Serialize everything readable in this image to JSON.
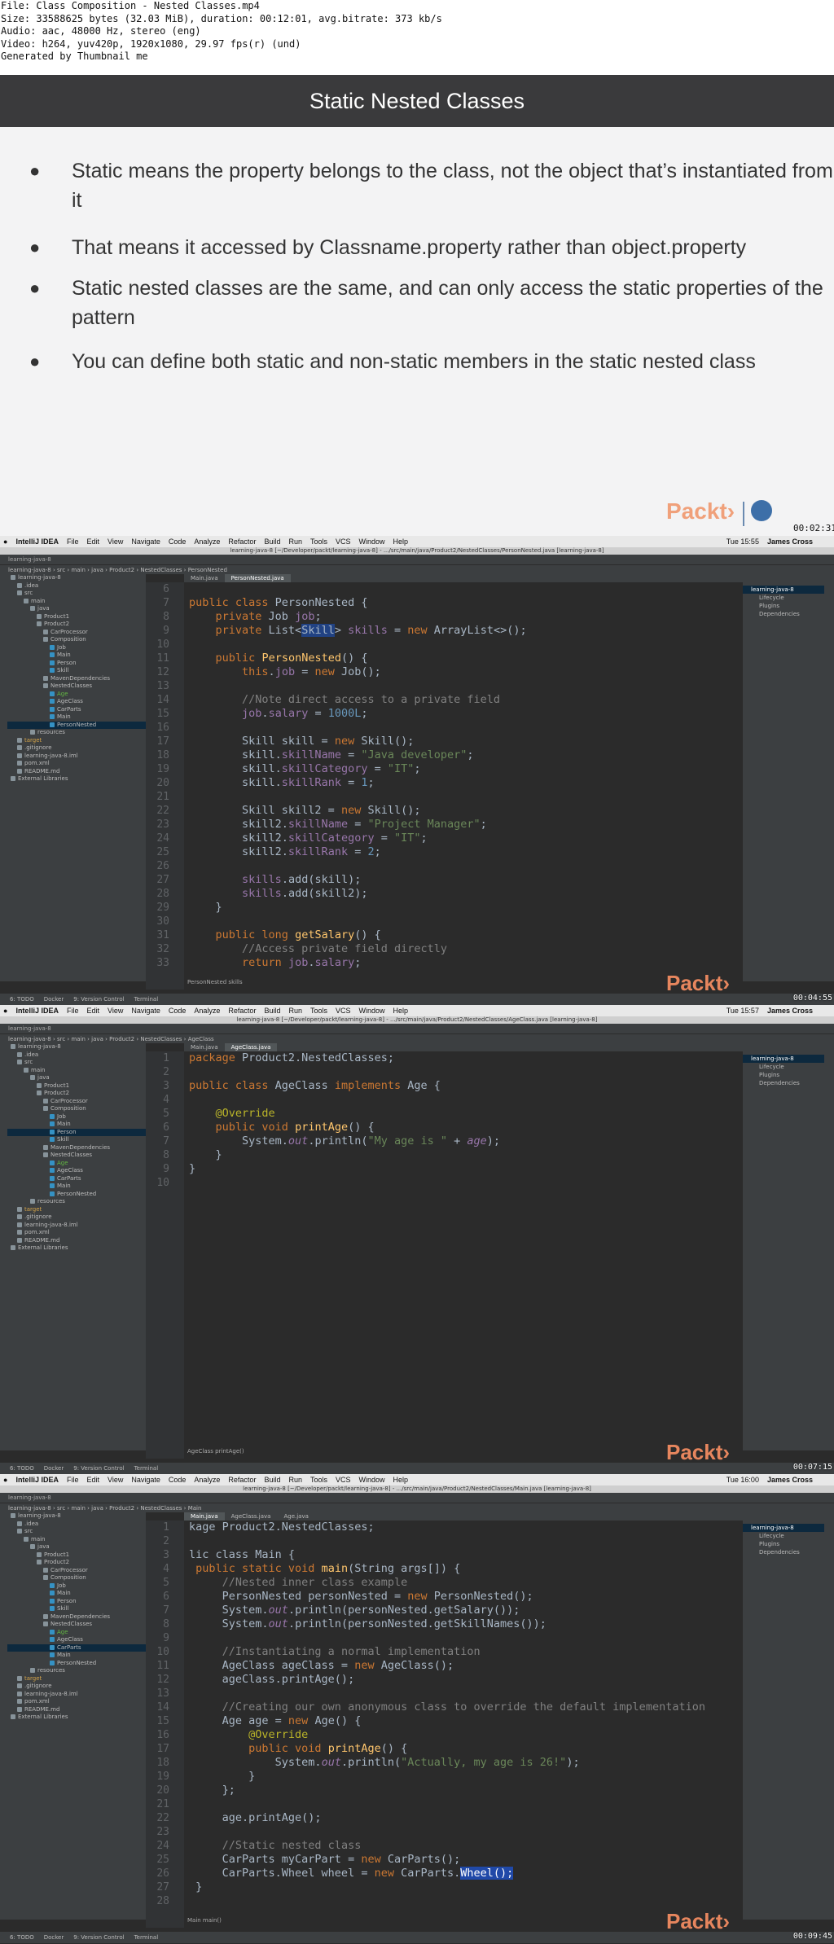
{
  "header": {
    "lines": [
      "File: Class Composition - Nested Classes.mp4",
      "Size: 33588625 bytes (32.03 MiB), duration: 00:12:01, avg.bitrate: 373 kb/s",
      "Audio: aac, 48000 Hz, stereo (eng)",
      "Video: h264, yuv420p, 1920x1080, 29.97 fps(r) (und)",
      "Generated by Thumbnail me"
    ]
  },
  "slide": {
    "title": "Static Nested Classes",
    "bullets": [
      "Static means the property belongs to the class, not the object that’s instantiated  from it",
      "That means it accessed by Classname.property rather than object.property",
      "Static nested classes are the same, and can only access the static properties of the pattern",
      "You can define both static and non-static members in the static nested class"
    ],
    "logo": "Packt›",
    "timestamp": "00:02:31"
  },
  "ide_common": {
    "menus": [
      "IntelliJ IDEA",
      "File",
      "Edit",
      "View",
      "Navigate",
      "Code",
      "Analyze",
      "Refactor",
      "Build",
      "Run",
      "Tools",
      "VCS",
      "Window",
      "Help"
    ],
    "user": "James Cross",
    "project_root": "learning-java-8",
    "tree": [
      {
        "label": "learning-java-8",
        "indent": 0,
        "color": "#bbbbbb"
      },
      {
        "label": ".idea",
        "indent": 1,
        "color": "#bbbbbb"
      },
      {
        "label": "src",
        "indent": 1,
        "color": "#bbbbbb"
      },
      {
        "label": "main",
        "indent": 2,
        "color": "#bbbbbb"
      },
      {
        "label": "java",
        "indent": 3,
        "color": "#bbbbbb"
      },
      {
        "label": "Product1",
        "indent": 4,
        "color": "#bbbbbb"
      },
      {
        "label": "Product2",
        "indent": 4,
        "color": "#bbbbbb"
      },
      {
        "label": "CarProcessor",
        "indent": 5,
        "color": "#bbbbbb"
      },
      {
        "label": "Composition",
        "indent": 5,
        "color": "#bbbbbb"
      },
      {
        "label": "Job",
        "indent": 6,
        "color": "#bbbbbb"
      },
      {
        "label": "Main",
        "indent": 6,
        "color": "#bbbbbb"
      },
      {
        "label": "Person",
        "indent": 6,
        "color": "#bbbbbb"
      },
      {
        "label": "Skill",
        "indent": 6,
        "color": "#bbbbbb"
      },
      {
        "label": "MavenDependencies",
        "indent": 5,
        "color": "#bbbbbb"
      },
      {
        "label": "NestedClasses",
        "indent": 5,
        "color": "#bbbbbb"
      },
      {
        "label": "Age",
        "indent": 6,
        "color": "#62b543"
      },
      {
        "label": "AgeClass",
        "indent": 6,
        "color": "#bbbbbb"
      },
      {
        "label": "CarParts",
        "indent": 6,
        "color": "#bbbbbb"
      },
      {
        "label": "Main",
        "indent": 6,
        "color": "#bbbbbb"
      },
      {
        "label": "PersonNested",
        "indent": 6,
        "color": "#bbbbbb"
      },
      {
        "label": "resources",
        "indent": 3,
        "color": "#bbbbbb"
      },
      {
        "label": "target",
        "indent": 1,
        "color": "#d6a54a"
      },
      {
        "label": ".gitignore",
        "indent": 1,
        "color": "#bbbbbb"
      },
      {
        "label": "learning-java-8.iml",
        "indent": 1,
        "color": "#bbbbbb"
      },
      {
        "label": "pom.xml",
        "indent": 1,
        "color": "#bbbbbb"
      },
      {
        "label": "README.md",
        "indent": 1,
        "color": "#bbbbbb"
      },
      {
        "label": "External Libraries",
        "indent": 0,
        "color": "#bbbbbb"
      }
    ],
    "maven": [
      "learning-java-8",
      "Lifecycle",
      "Plugins",
      "Dependencies"
    ],
    "status_tools": [
      "6: TODO",
      "Docker",
      "9: Version Control",
      "Terminal"
    ]
  },
  "panel1": {
    "time": "Tue 15:55",
    "path": "learning-java-8 [~/Developer/packt/learning-java-8] - .../src/main/java/Product2/NestedClasses/PersonNested.java [learning-java-8]",
    "crumbs": "learning-java-8 › src › main › java › Product2 › NestedClasses › PersonNested",
    "tabs": [
      "Main.java",
      "PersonNested.java"
    ],
    "selected_tree": "PersonNested",
    "first_line": 6,
    "lines": [
      "",
      "<span class='kw'>public class</span> PersonNested {",
      "    <span class='kw'>private</span> Job <span class='fld'>job</span>;",
      "    <span class='kw'>private</span> List&lt;<span class='sel-text'>Skill</span>&gt; <span class='fld'>skills</span> = <span class='kw'>new</span> ArrayList&lt;&gt;();",
      "",
      "    <span class='kw'>public</span> <span class='fn'>PersonNested</span>() {",
      "        <span class='kw'>this</span>.<span class='fld'>job</span> = <span class='kw'>new</span> Job();",
      "",
      "        <span class='cmt'>//Note direct access to a private field</span>",
      "        <span class='fld'>job</span>.<span class='fld'>salary</span> = <span class='num'>1000L</span>;",
      "",
      "        Skill skill = <span class='kw'>new</span> Skill();",
      "        skill.<span class='fld'>skillName</span> = <span class='str'>\"Java developer\"</span>;",
      "        skill.<span class='fld'>skillCategory</span> = <span class='str'>\"IT\"</span>;",
      "        skill.<span class='fld'>skillRank</span> = <span class='num'>1</span>;",
      "",
      "        Skill skill2 = <span class='kw'>new</span> Skill();",
      "        skill2.<span class='fld'>skillName</span> = <span class='str'>\"Project Manager\"</span>;",
      "        skill2.<span class='fld'>skillCategory</span> = <span class='str'>\"IT\"</span>;",
      "        skill2.<span class='fld'>skillRank</span> = <span class='num'>2</span>;",
      "",
      "        <span class='fld'>skills</span>.add(skill);",
      "        <span class='fld'>skills</span>.add(skill2);",
      "    }",
      "",
      "    <span class='kw'>public long</span> <span class='fn'>getSalary</span>() {",
      "        <span class='cmt'>//Access private field directly</span>",
      "        <span class='kw'>return</span> <span class='fld'>job</span>.<span class='fld'>salary</span>;"
    ],
    "footer_crumb": "PersonNested   skills",
    "logo": "Packt›",
    "timestamp": "00:04:55"
  },
  "panel2": {
    "time": "Tue 15:57",
    "path": "learning-java-8 [~/Developer/packt/learning-java-8] - .../src/main/java/Product2/NestedClasses/AgeClass.java [learning-java-8]",
    "crumbs": "learning-java-8 › src › main › java › Product2 › NestedClasses › AgeClass",
    "tabs": [
      "Main.java",
      "AgeClass.java"
    ],
    "selected_tree": "Person",
    "first_line": 1,
    "lines": [
      "<span class='kw'>package</span> Product2.NestedClasses;",
      "",
      "<span class='kw'>public class</span> AgeClass <span class='kw'>implements</span> Age {",
      "",
      "    <span class='ann'>@Override</span>",
      "    <span class='kw'>public void</span> <span class='fn'>printAge</span>() {",
      "        System.<span class='fld ital'>out</span>.println(<span class='str'>\"My age is \"</span> + <span class='fld ital'>age</span>);",
      "    }",
      "}",
      ""
    ],
    "footer_crumb": "AgeClass   printAge()",
    "logo": "Packt›",
    "timestamp": "00:07:15"
  },
  "panel3": {
    "time": "Tue 16:00",
    "path": "learning-java-8 [~/Developer/packt/learning-java-8] - .../src/main/java/Product2/NestedClasses/Main.java [learning-java-8]",
    "crumbs": "learning-java-8 › src › main › java › Product2 › NestedClasses › Main",
    "tabs": [
      "Main.java",
      "AgeClass.java",
      "Age.java"
    ],
    "selected_tree": "CarParts",
    "first_line": 1,
    "lines": [
      "kage Product2.NestedClasses;",
      "",
      "lic class Main {",
      " <span class='kw'>public static void</span> <span class='fn'>main</span>(String args[]) {",
      "     <span class='cmt'>//Nested inner class example</span>",
      "     PersonNested personNested = <span class='kw'>new</span> PersonNested();",
      "     System.<span class='fld ital'>out</span>.println(personNested.getSalary());",
      "     System.<span class='fld ital'>out</span>.println(personNested.getSkillNames());",
      "",
      "     <span class='cmt'>//Instantiating a normal implementation</span>",
      "     AgeClass ageClass = <span class='kw'>new</span> AgeClass();",
      "     ageClass.printAge();",
      "",
      "     <span class='cmt'>//Creating our own anonymous class to override the default implementation</span>",
      "     Age age = <span class='kw'>new</span> Age() {",
      "         <span class='ann'>@Override</span>",
      "         <span class='kw'>public void</span> <span class='fn'>printAge</span>() {",
      "             System.<span class='fld ital'>out</span>.println(<span class='str'>\"Actually, my age is 26!\"</span>);",
      "         }",
      "     };",
      "",
      "     age.printAge();",
      "",
      "     <span class='cmt'>//Static nested class</span>",
      "     CarParts myCarPart = <span class='kw'>new</span> CarParts();",
      "     CarParts.Wheel wheel = <span class='kw'>new</span> CarParts.<span class='bluebox'>Wheel();</span>",
      " }",
      ""
    ],
    "footer_crumb": "Main   main()",
    "logo": "Packt›",
    "timestamp": "00:09:45"
  }
}
